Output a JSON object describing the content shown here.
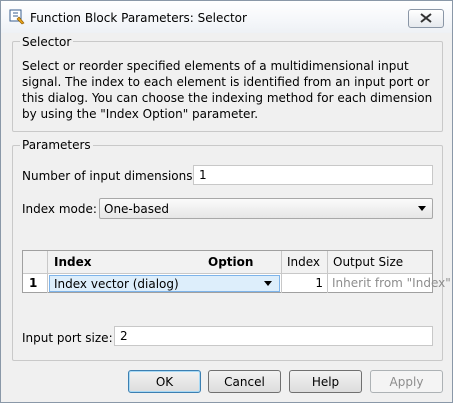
{
  "window": {
    "title": "Function Block Parameters: Selector",
    "close_icon": "close-x-icon"
  },
  "block": {
    "name": "Selector",
    "description": "Select or reorder specified elements of a multidimensional input signal. The index to each element is identified from an input port or this dialog. You can choose the indexing method for each dimension by using the \"Index Option\" parameter."
  },
  "parameters": {
    "title": "Parameters",
    "num_dims_label": "Number of input dimensions:",
    "num_dims_value": "1",
    "index_mode_label": "Index mode:",
    "index_mode_value": "One-based",
    "input_port_size_label": "Input port size:",
    "input_port_size_value": "2"
  },
  "table": {
    "headers": {
      "index": "Index",
      "option": "Option",
      "index_col": "Index",
      "output_size": "Output Size"
    },
    "rows": [
      {
        "row_num": "1",
        "option": "Index vector (dialog)",
        "index": "1",
        "output_size": "Inherit from \"Index\""
      }
    ]
  },
  "buttons": {
    "ok": "OK",
    "cancel": "Cancel",
    "help": "Help",
    "apply": "Apply"
  },
  "colors": {
    "selected_cell_bg": "#ddeefb",
    "disabled_text": "#8d8d8d"
  }
}
